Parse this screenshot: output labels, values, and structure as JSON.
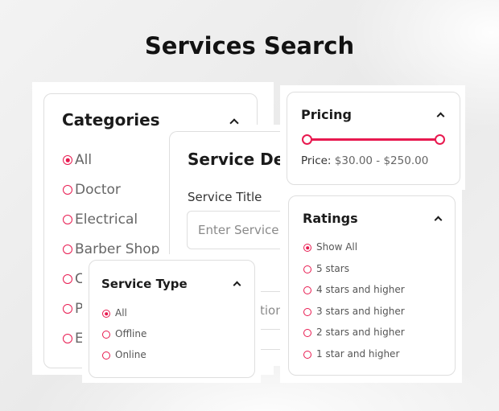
{
  "page": {
    "title": "Services Search"
  },
  "categories": {
    "title": "Categories",
    "options": [
      "All",
      "Doctor",
      "Electrical",
      "Barber Shop",
      "C",
      "P",
      "E"
    ],
    "selected": "All"
  },
  "service_details": {
    "title": "Service Deta",
    "field_label": "Service Title",
    "field_placeholder": "Enter Service",
    "second_field_text": "tion"
  },
  "pricing": {
    "title": "Pricing",
    "price_label": "Price:",
    "price_range": "$30.00 - $250.00",
    "min": 30,
    "max": 250,
    "accent": "#e8194f"
  },
  "ratings": {
    "title": "Ratings",
    "options": [
      "Show All",
      "5 stars",
      "4 stars and higher",
      "3 stars and higher",
      "2 stars and higher",
      "1 star and higher"
    ],
    "selected": "Show All"
  },
  "service_type": {
    "title": "Service Type",
    "options": [
      "All",
      "Offline",
      "Online"
    ],
    "selected": "All"
  }
}
